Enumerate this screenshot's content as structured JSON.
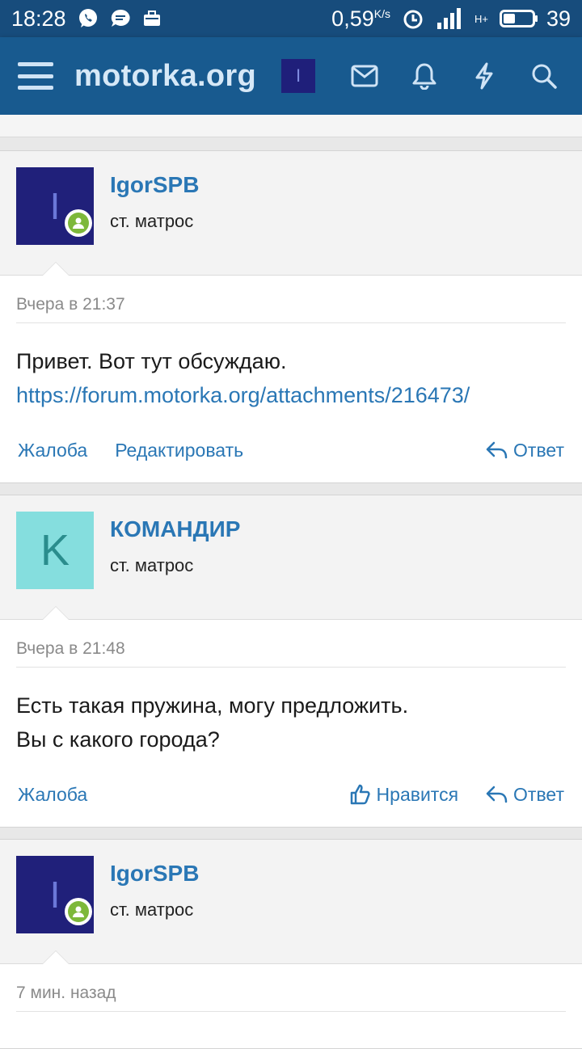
{
  "status": {
    "time": "18:28",
    "speed": "0,59",
    "speed_unit": "K/s",
    "network": "H+",
    "battery": "39"
  },
  "header": {
    "logo": "motorka.org",
    "user_initial": "I"
  },
  "posts": [
    {
      "username": "IgorSPB",
      "user_title": "ст. матрос",
      "avatar_initial": "I",
      "date": "Вчера в 21:37",
      "text_line1": "Привет. Вот тут обсуждаю.",
      "link": "https://forum.motorka.org/attachments/216473/",
      "action_report": "Жалоба",
      "action_edit": "Редактировать",
      "action_reply": "Ответ"
    },
    {
      "username": "КОМАНДИР",
      "user_title": "ст. матрос",
      "avatar_initial": "K",
      "date": "Вчера в 21:48",
      "text_line1": "Есть такая пружина, могу предложить.",
      "text_line2": "Вы с какого города?",
      "action_report": "Жалоба",
      "action_like": "Нравится",
      "action_reply": "Ответ"
    },
    {
      "username": "IgorSPB",
      "user_title": "ст. матрос",
      "avatar_initial": "I",
      "date": "7 мин. назад"
    }
  ]
}
